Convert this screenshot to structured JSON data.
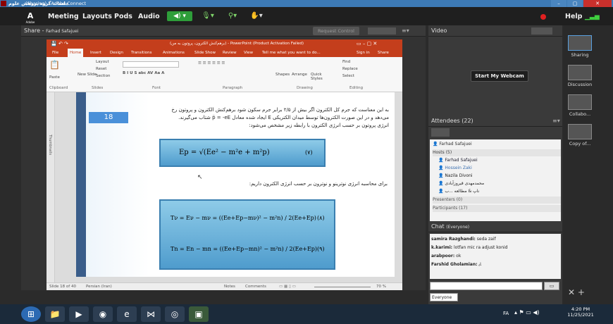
{
  "window": {
    "title": "(Sharing) - Adobe Connect",
    "caption": "جلسات گروه پروهش علوم",
    "minimize": "–",
    "maximize": "▢",
    "close": "✕"
  },
  "menubar": {
    "logo": "Adobe",
    "items": [
      "Meeting",
      "Layouts",
      "Pods",
      "Audio"
    ],
    "help": "Help"
  },
  "share_pod": {
    "title": "Share",
    "presenter": "Farhad Safajuei",
    "request_control": "Request Control"
  },
  "ppt": {
    "title": "(برهم‌کنش الکترون، پروتون به من) - PowerPoint (Product Activation Failed)",
    "tabs": [
      "File",
      "Home",
      "Insert",
      "Design",
      "Transitions",
      "Animations",
      "Slide Show",
      "Review",
      "View"
    ],
    "tell": "Tell me what you want to do...",
    "signin": "Sign in",
    "share": "Share",
    "ribbon": {
      "paste": "Paste",
      "new_slide": "New Slide",
      "layout": "Layout",
      "reset": "Reset",
      "section": "Section",
      "shapes": "Shapes",
      "arrange": "Arrange",
      "quick_styles": "Quick Styles",
      "find": "Find",
      "replace": "Replace",
      "select": "Select",
      "groups": [
        "Clipboard",
        "Slides",
        "Font",
        "Paragraph",
        "Drawing",
        "Editing"
      ]
    },
    "thumbnails": "Thumbnails",
    "status": {
      "slide": "Slide 18 of 40",
      "lang": "Persian (Iran)",
      "notes": "Notes",
      "comments": "Comments",
      "zoom": "70 %"
    }
  },
  "slide": {
    "number": "18",
    "text1": "به این معناست که جرم کل الکترون اگر بیش از ۲/۵ برابر جرم سکون شود برهم‌کنش الکترون و پروتون رخ",
    "text2": "می‌دهد و در این صورت الکترون‌ها توسط میدان الکتریکی E ایجاد شده معادل p̈ = -eE شتاب می‌گیرند.",
    "text3": "انرژی پروتون بر حسب انرژی الکترون با رابطه زیر مشخص می‌شود:",
    "eq7": "Ep = √(Ee² − m²e + m²p)",
    "eq7num": "(۷)",
    "text4": "برای محاسبه انرژی نوترینو و نوترون بر حسب انرژی الکترون داریم:",
    "eq8": "Tν = Eν − mν = ((Ee+Ep−mν)² − m²n) / 2(Ee+Ep)",
    "eq8num": "(۸)",
    "eq9": "Tn = En − mn = ((Ee+Ep−mn)² − m²n) / 2(Ee+Ep)",
    "eq9num": "(۹)"
  },
  "video_pod": {
    "title": "Video",
    "button": "Start My Webcam"
  },
  "attendees": {
    "title": "Attendees",
    "count": "(22)",
    "host_self": "Farhad Safajuei",
    "hosts_label": "Hosts (5)",
    "hosts": [
      "Farhad Safajuei",
      "Hossein Zaki",
      "Nazila Divoni",
      "محمدمهدی قیروزآبادی",
      "ناپ & مطالعه ...ب"
    ],
    "presenters_label": "Presenters (0)",
    "participants_label": "Participants (17)"
  },
  "chat": {
    "title": "Chat",
    "scope": "(Everyone)",
    "messages": [
      {
        "who": "samira Razghandi:",
        "text": "seda zaif"
      },
      {
        "who": "k.karimi:",
        "text": "lotfan mic ra adjust konid"
      },
      {
        "who": "arabpoor:",
        "text": "ok"
      },
      {
        "who": "Farshid Gholamian:",
        "text": "ﺎﯾ"
      }
    ],
    "recipient": "Everyone"
  },
  "layouts": [
    "Sharing",
    "Discussion",
    "Collabo...",
    "Copy of..."
  ],
  "taskbar": {
    "lang": "FA",
    "time": "4:20 PM",
    "date": "11/25/2021"
  },
  "colors": {
    "ppt_red": "#c43e1c",
    "eq_blue": "#6ab3dd",
    "slide_badge": "#4a90d9"
  }
}
